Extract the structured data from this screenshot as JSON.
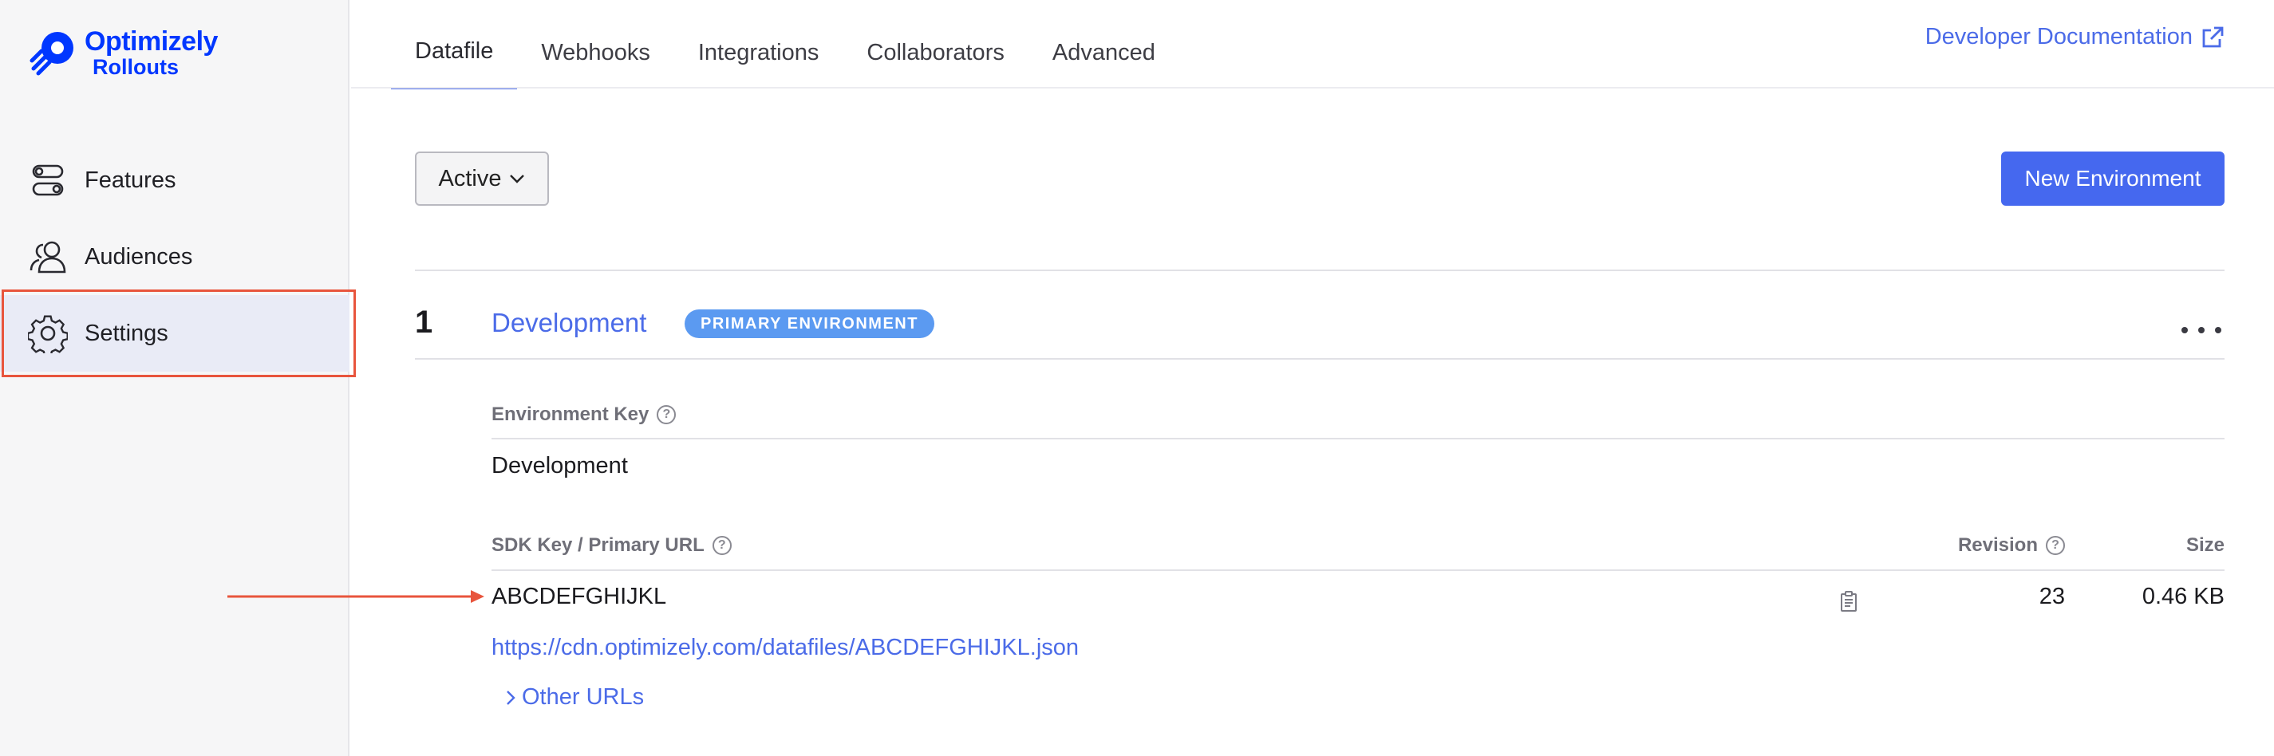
{
  "brand": {
    "line1": "Optimizely",
    "line2": "Rollouts",
    "color": "#0037ff"
  },
  "sidebar": {
    "items": [
      {
        "label": "Features",
        "icon": "toggle-icon"
      },
      {
        "label": "Audiences",
        "icon": "users-icon"
      },
      {
        "label": "Settings",
        "icon": "gear-icon",
        "active": true
      }
    ]
  },
  "tabs": [
    {
      "label": "Datafile",
      "active": true
    },
    {
      "label": "Webhooks"
    },
    {
      "label": "Integrations"
    },
    {
      "label": "Collaborators"
    },
    {
      "label": "Advanced"
    }
  ],
  "header": {
    "doc_link": "Developer Documentation",
    "doc_icon": "external-link-icon"
  },
  "toolbar": {
    "filter_value": "Active",
    "new_env_label": "New Environment",
    "accent": "#4568ef"
  },
  "environment": {
    "number": "1",
    "name": "Development",
    "badge": "PRIMARY ENVIRONMENT",
    "badge_color": "#5b9af1",
    "env_key_label": "Environment Key",
    "env_key_value": "Development",
    "sdk_label": "SDK Key / Primary URL",
    "revision_label": "Revision",
    "size_label": "Size",
    "sdk_key": "ABCDEFGHIJKL",
    "revision": "23",
    "size": "0.46 KB",
    "cdn_url": "https://cdn.optimizely.com/datafiles/ABCDEFGHIJKL.json",
    "other_urls": "Other URLs"
  },
  "annotation_color": "#e8553d"
}
